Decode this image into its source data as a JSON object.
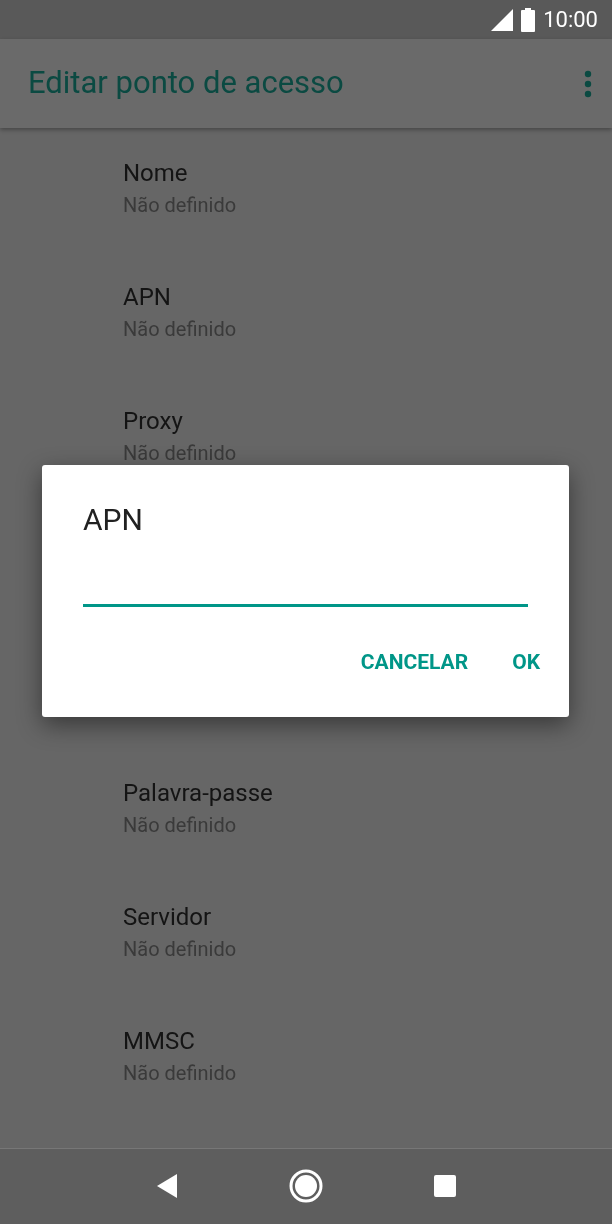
{
  "status_bar": {
    "time": "10:00"
  },
  "app_bar": {
    "title": "Editar ponto de acesso"
  },
  "items": [
    {
      "kind": "full",
      "title": "Nome",
      "value": "Não definido"
    },
    {
      "kind": "full",
      "title": "APN",
      "value": "Não definido"
    },
    {
      "kind": "full",
      "title": "Proxy",
      "value": "Não definido"
    },
    {
      "kind": "covered"
    },
    {
      "kind": "full",
      "title": "Palavra-passe",
      "value": "Não definido"
    },
    {
      "kind": "full",
      "title": "Servidor",
      "value": "Não definido"
    },
    {
      "kind": "full",
      "title": "MMSC",
      "value": "Não definido"
    }
  ],
  "dialog": {
    "title": "APN",
    "buttons": [
      "CANCELAR",
      "OK"
    ]
  }
}
